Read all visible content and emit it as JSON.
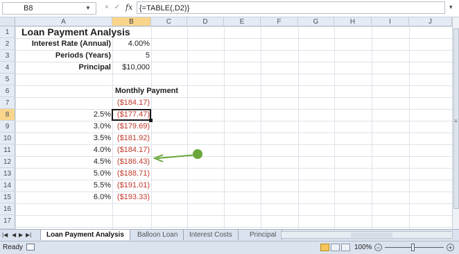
{
  "formula_bar": {
    "name_box": "B8",
    "cancel": "×",
    "enter": "✓",
    "fx": "fx",
    "formula": "{=TABLE(,D2)}"
  },
  "columns": [
    "A",
    "B",
    "C",
    "D",
    "E",
    "F",
    "G",
    "H",
    "I",
    "J"
  ],
  "rows": [
    "1",
    "2",
    "3",
    "4",
    "5",
    "6",
    "7",
    "8",
    "9",
    "10",
    "11",
    "12",
    "13",
    "14",
    "15",
    "16",
    "17"
  ],
  "cells": {
    "title": "Loan Payment Analysis",
    "interest_label": "Interest Rate (Annual)",
    "interest_value": "4.00%",
    "periods_label": "Periods (Years)",
    "periods_value": "5",
    "principal_label": "Principal",
    "principal_value": "$10,000",
    "payment_header": "Monthly Payment",
    "base_payment": "($184.17)"
  },
  "table_rows": [
    {
      "rate": "2.5%",
      "payment": "($177.47)"
    },
    {
      "rate": "3.0%",
      "payment": "($179.69)"
    },
    {
      "rate": "3.5%",
      "payment": "($181.92)"
    },
    {
      "rate": "4.0%",
      "payment": "($184.17)"
    },
    {
      "rate": "4.5%",
      "payment": "($186.43)"
    },
    {
      "rate": "5.0%",
      "payment": "($188.71)"
    },
    {
      "rate": "5.5%",
      "payment": "($191.01)"
    },
    {
      "rate": "6.0%",
      "payment": "($193.33)"
    }
  ],
  "sheet_tabs": {
    "active": "Loan Payment Analysis",
    "tab2": "Balloon Loan",
    "tab3": "Interest Costs",
    "tab4": "Principal"
  },
  "status_bar": {
    "status": "Ready",
    "zoom": "100%",
    "zoom_minus": "−",
    "zoom_plus": "+"
  },
  "colors": {
    "accent_selection": "#f8d58a",
    "negative_value": "#c0392b",
    "arrow": "#6aa63a"
  }
}
